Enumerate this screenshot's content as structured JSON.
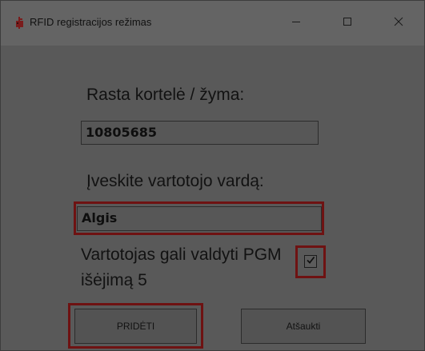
{
  "window": {
    "title": "RFID registracijos režimas",
    "icon": "rfid-app-icon",
    "controls": {
      "minimize": "minimize-icon",
      "maximize": "maximize-icon",
      "close": "close-icon"
    }
  },
  "form": {
    "card_label": "Rasta kortelė / žyma:",
    "card_value": "10805685",
    "name_label": "Įveskite vartotojo vardą:",
    "name_value": "Algis",
    "permission_label": "Vartotojas gali valdyti PGM išėjimą 5",
    "permission_checked": true
  },
  "buttons": {
    "add_label": "PRIDĖTI",
    "cancel_label": "Atšaukti"
  },
  "colors": {
    "highlight": "#6e1212",
    "app_icon": "#7a1c1c"
  }
}
